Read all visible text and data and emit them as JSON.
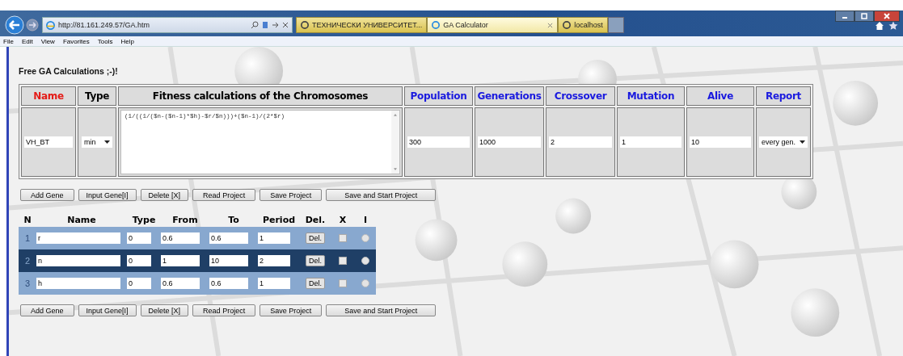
{
  "browser": {
    "address": "http://81.161.249.57/GA.htm",
    "tabs": [
      {
        "title": "ТЕХНИЧЕСКИ УНИВЕРСИТЕТ...",
        "selected": false
      },
      {
        "title": "GA Calculator",
        "selected": true
      },
      {
        "title": "localhost",
        "selected": false
      }
    ],
    "menu": [
      "File",
      "Edit",
      "View",
      "Favorites",
      "Tools",
      "Help"
    ]
  },
  "page": {
    "title": "Free GA Calculations ;-)!",
    "project": {
      "columns": [
        {
          "label": "Name",
          "color": "#e41b17"
        },
        {
          "label": "Type",
          "color": "#000000"
        },
        {
          "label": "Fitness calculations of the Chromosomes",
          "color": "#000000"
        },
        {
          "label": "Population",
          "color": "#1a1adf"
        },
        {
          "label": "Generations",
          "color": "#1a1adf"
        },
        {
          "label": "Crossover",
          "color": "#1a1adf"
        },
        {
          "label": "Mutation",
          "color": "#1a1adf"
        },
        {
          "label": "Alive",
          "color": "#1a1adf"
        },
        {
          "label": "Report",
          "color": "#1a1adf"
        }
      ],
      "name": "VH_BT",
      "type": "min",
      "fitness": "(1/((1/($n-($n-1)*$h)-$r/$n)))+($n-1)/(2*$r)",
      "numbers": [
        "300",
        "1000",
        "2",
        "1",
        "10"
      ],
      "report": "every gen."
    },
    "buttons_top": [
      "Add Gene",
      "Input Gene[I]",
      "Delete [X]",
      "Read Project",
      "Save Project",
      "Save and Start Project"
    ],
    "genes": {
      "columns": [
        "N",
        "Name",
        "Type",
        "From",
        "To",
        "Period",
        "Del.",
        "X",
        "I"
      ],
      "rows": [
        {
          "n": "1",
          "name": "r",
          "type": "0",
          "from": "0.6",
          "to": "0.6",
          "period": "1",
          "del": "Del.",
          "checked": false,
          "radio": false,
          "selected": false
        },
        {
          "n": "2",
          "name": "n",
          "type": "0",
          "from": "1",
          "to": "10",
          "period": "2",
          "del": "Del.",
          "checked": false,
          "radio": false,
          "selected": true
        },
        {
          "n": "3",
          "name": "h",
          "type": "0",
          "from": "0.6",
          "to": "0.6",
          "period": "1",
          "del": "Del.",
          "checked": false,
          "radio": false,
          "selected": false
        }
      ]
    },
    "buttons_bottom": [
      "Add Gene",
      "Input Gene[I]",
      "Delete [X]",
      "Read Project",
      "Save Project",
      "Save and Start Project"
    ]
  }
}
